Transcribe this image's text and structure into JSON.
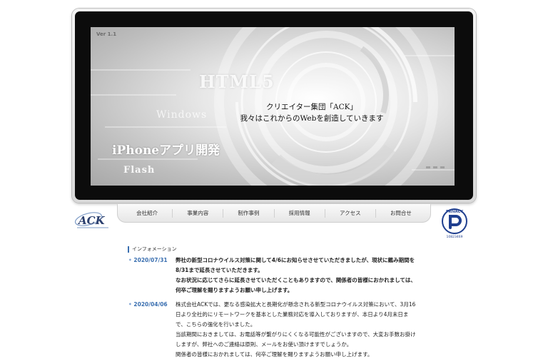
{
  "hero": {
    "version": "Ver 1.1",
    "html5": "HTML5",
    "windows": "Windows",
    "iphone": "iPhoneアプリ開発",
    "flash": "Flash",
    "tagline_line1": "クリエイター集団「ACK」",
    "tagline_line2": "我々はこれからのWebを創造していきます"
  },
  "nav": {
    "items": [
      "会社紹介",
      "事業内容",
      "制作事例",
      "採用情報",
      "アクセス",
      "お問合せ"
    ]
  },
  "logo": {
    "icon": "ack-logo",
    "text": "ACK"
  },
  "privacy": {
    "icon": "privacy-mark",
    "label": "PRIVACY",
    "number": "10823469"
  },
  "info": {
    "heading": "インフォメーション",
    "entries": [
      {
        "date": "2020/07/31",
        "lines": [
          "弊社の新型コロナウイルス対策に関して4/6にお知らせさせていただきましたが、現状に鑑み期間を",
          "8/31まで延長させていただきます。",
          "なお状況に応じてさらに延長させていただくこともありますので、関係者の皆様におかれましては、",
          "何卒ご理解を賜りますようお願い申し上げます。"
        ]
      },
      {
        "date": "2020/04/06",
        "lines": [
          "株式会社ACKでは、更なる感染拡大と長期化が懸念される新型コロナウイルス対策において、3月16",
          "日より全社的にリモートワークを基本とした業務対応を導入しておりますが、本日より4月末日ま",
          "で、こちらの強化を行いました。",
          "当該期間におきましては、お電話等が繋がりにくくなる可能性がございますので、大変お手数お掛け",
          "しますが、弊社へのご連絡は原則、メールをお使い頂けますでしょうか。",
          "関係者の皆様におかれましては、何卒ご理解を賜りますようお願い申し上げます。"
        ]
      }
    ]
  }
}
